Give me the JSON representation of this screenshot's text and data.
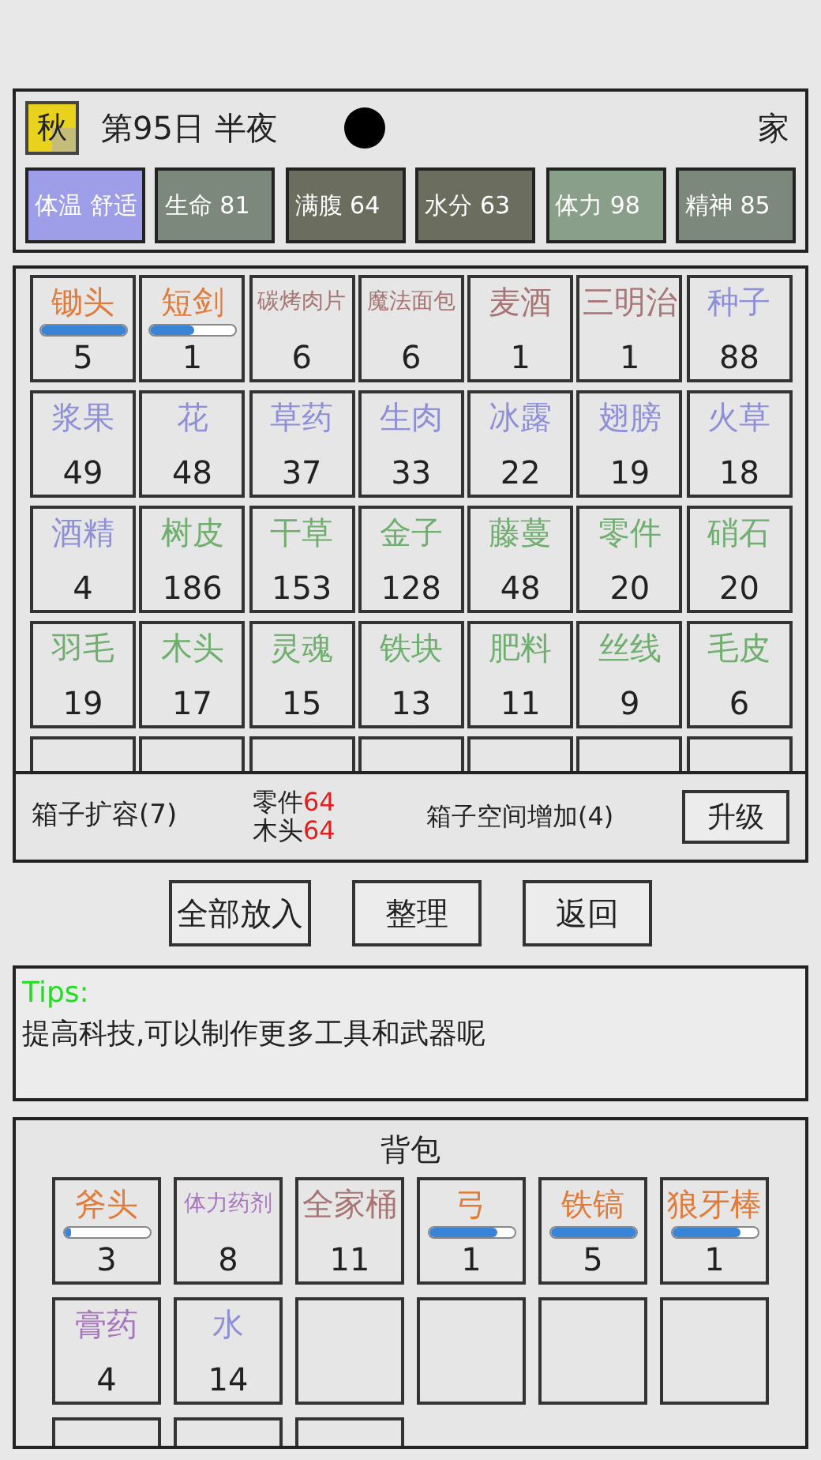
{
  "header": {
    "season": "秋",
    "day": "第95日 半夜",
    "location": "家"
  },
  "stats": [
    {
      "label": "体温 舒适",
      "color": "#9d9de8"
    },
    {
      "label": "生命 81",
      "color": "#7b887b"
    },
    {
      "label": "满腹 64",
      "color": "#6b6d5e"
    },
    {
      "label": "水分 63",
      "color": "#6b6d5e"
    },
    {
      "label": "体力 98",
      "color": "#8a9f8a"
    },
    {
      "label": "精神 85",
      "color": "#7b887b"
    }
  ],
  "chest": {
    "items": [
      {
        "kind": "item",
        "name": "锄头",
        "count": "5",
        "color": "#e07b39",
        "level": 1
      },
      {
        "kind": "item",
        "name": "短剑",
        "count": "1",
        "color": "#e07b39",
        "level": 0.52
      },
      {
        "kind": "item",
        "name": "碳烤肉片",
        "count": "6",
        "color": "#a87474"
      },
      {
        "kind": "item",
        "name": "魔法面包",
        "count": "6",
        "color": "#a87474"
      },
      {
        "kind": "item",
        "name": "麦酒",
        "count": "1",
        "color": "#a87474"
      },
      {
        "kind": "item",
        "name": "三明治",
        "count": "1",
        "color": "#a87474"
      },
      {
        "kind": "item",
        "name": "种子",
        "count": "88",
        "color": "#8f8fd8"
      },
      {
        "kind": "item",
        "name": "浆果",
        "count": "49",
        "color": "#8f8fd8"
      },
      {
        "kind": "item",
        "name": "花",
        "count": "48",
        "color": "#8f8fd8"
      },
      {
        "kind": "item",
        "name": "草药",
        "count": "37",
        "color": "#8f8fd8"
      },
      {
        "kind": "item",
        "name": "生肉",
        "count": "33",
        "color": "#8f8fd8"
      },
      {
        "kind": "item",
        "name": "冰露",
        "count": "22",
        "color": "#8f8fd8"
      },
      {
        "kind": "item",
        "name": "翅膀",
        "count": "19",
        "color": "#8f8fd8"
      },
      {
        "kind": "item",
        "name": "火草",
        "count": "18",
        "color": "#8f8fd8"
      },
      {
        "kind": "item",
        "name": "酒精",
        "count": "4",
        "color": "#8f8fd8"
      },
      {
        "kind": "item",
        "name": "树皮",
        "count": "186",
        "color": "#6fae6f"
      },
      {
        "kind": "item",
        "name": "干草",
        "count": "153",
        "color": "#6fae6f"
      },
      {
        "kind": "item",
        "name": "金子",
        "count": "128",
        "color": "#6fae6f"
      },
      {
        "kind": "item",
        "name": "藤蔓",
        "count": "48",
        "color": "#6fae6f"
      },
      {
        "kind": "item",
        "name": "零件",
        "count": "20",
        "color": "#6fae6f"
      },
      {
        "kind": "item",
        "name": "硝石",
        "count": "20",
        "color": "#6fae6f"
      },
      {
        "kind": "item",
        "name": "羽毛",
        "count": "19",
        "color": "#6fae6f"
      },
      {
        "kind": "item",
        "name": "木头",
        "count": "17",
        "color": "#6fae6f"
      },
      {
        "kind": "item",
        "name": "灵魂",
        "count": "15",
        "color": "#6fae6f"
      },
      {
        "kind": "item",
        "name": "铁块",
        "count": "13",
        "color": "#6fae6f"
      },
      {
        "kind": "item",
        "name": "肥料",
        "count": "11",
        "color": "#6fae6f"
      },
      {
        "kind": "item",
        "name": "丝线",
        "count": "9",
        "color": "#6fae6f"
      },
      {
        "kind": "item",
        "name": "毛皮",
        "count": "6",
        "color": "#6fae6f"
      },
      {
        "kind": "cut"
      },
      {
        "kind": "cut"
      },
      {
        "kind": "cut"
      },
      {
        "kind": "cut"
      },
      {
        "kind": "cut"
      },
      {
        "kind": "cut"
      },
      {
        "kind": "cut"
      }
    ]
  },
  "upgrade": {
    "title": "箱子扩容(7)",
    "costs": [
      {
        "name": "零件",
        "amount": "64"
      },
      {
        "name": "木头",
        "amount": "64"
      }
    ],
    "description": "箱子空间增加(4)",
    "button": "升级"
  },
  "buttons": [
    "全部放入",
    "整理",
    "返回"
  ],
  "tips": {
    "label": "Tips:",
    "text": "提高科技,可以制作更多工具和武器呢"
  },
  "backpack": {
    "title": "背包",
    "slots": [
      {
        "kind": "item",
        "name": "斧头",
        "count": "3",
        "color": "#e07b39",
        "level": 0.08
      },
      {
        "kind": "item",
        "name": "体力药剂",
        "count": "8",
        "color": "#a874c0"
      },
      {
        "kind": "item",
        "name": "全家桶",
        "count": "11",
        "color": "#a87474"
      },
      {
        "kind": "item",
        "name": "弓",
        "count": "1",
        "color": "#e07b39",
        "level": 0.8
      },
      {
        "kind": "item",
        "name": "铁镐",
        "count": "5",
        "color": "#e07b39",
        "level": 1
      },
      {
        "kind": "item",
        "name": "狼牙棒",
        "count": "1",
        "color": "#e07b39",
        "level": 0.8
      },
      {
        "kind": "item",
        "name": "膏药",
        "count": "4",
        "color": "#a874c0"
      },
      {
        "kind": "item",
        "name": "水",
        "count": "14",
        "color": "#8f8fd8"
      },
      {
        "kind": "empty"
      },
      {
        "kind": "empty"
      },
      {
        "kind": "empty"
      },
      {
        "kind": "empty"
      },
      {
        "kind": "empty"
      },
      {
        "kind": "empty"
      },
      {
        "kind": "empty"
      }
    ]
  }
}
